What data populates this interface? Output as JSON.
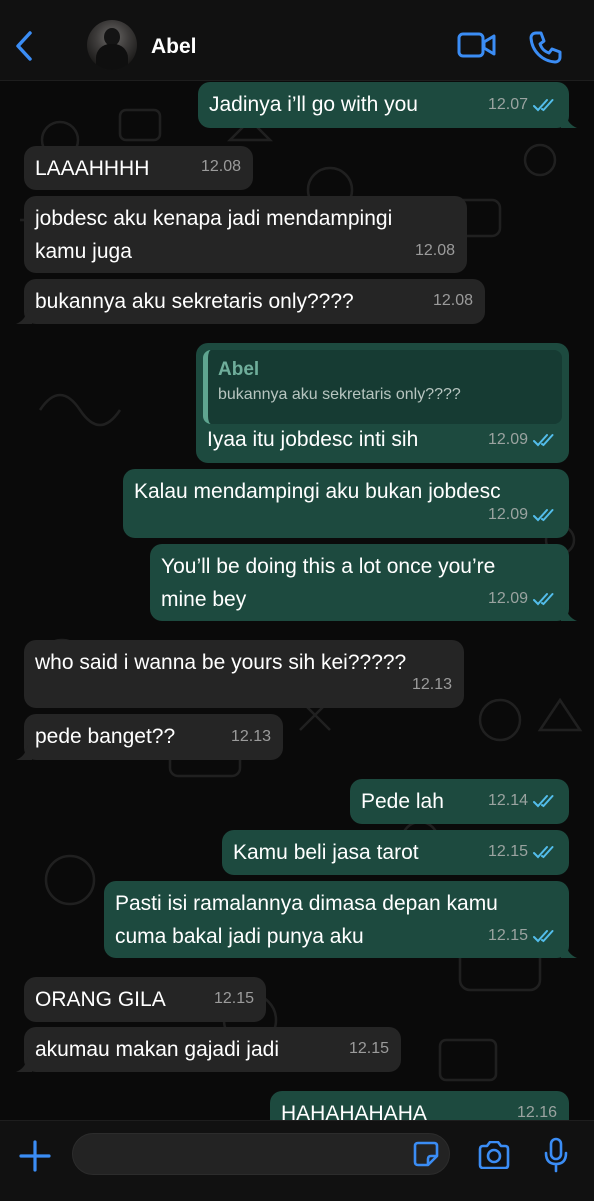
{
  "header": {
    "contact_name": "Abel"
  },
  "messages": [
    {
      "dir": "out",
      "text": "Jadinya i’ll go with you",
      "time": "12.07",
      "read": true
    },
    {
      "dir": "in",
      "text": "LAAAHHHH",
      "time": "12.08"
    },
    {
      "dir": "in",
      "text": "jobdesc aku kenapa jadi mendampingi\nkamu juga",
      "time": "12.08"
    },
    {
      "dir": "in",
      "text": "bukannya aku sekretaris only????",
      "time": "12.08"
    },
    {
      "dir": "out",
      "quote": {
        "name": "Abel",
        "text": "bukannya aku sekretaris only????"
      },
      "text": "Iyaa itu jobdesc inti sih",
      "time": "12.09",
      "read": true
    },
    {
      "dir": "out",
      "text": "Kalau mendampingi aku bukan jobdesc",
      "time": "12.09",
      "read": true
    },
    {
      "dir": "out",
      "text": "You’ll be doing this a lot once you’re\nmine bey",
      "time": "12.09",
      "read": true
    },
    {
      "dir": "in",
      "text": "who said i wanna be yours sih kei?????",
      "time": "12.13"
    },
    {
      "dir": "in",
      "text": "pede banget??",
      "time": "12.13"
    },
    {
      "dir": "out",
      "text": "Pede lah",
      "time": "12.14",
      "read": true
    },
    {
      "dir": "out",
      "text": "Kamu beli jasa tarot",
      "time": "12.15",
      "read": true
    },
    {
      "dir": "out",
      "text": "Pasti isi ramalannya dimasa depan kamu\ncuma bakal jadi punya aku",
      "time": "12.15",
      "read": true
    },
    {
      "dir": "in",
      "text": "ORANG GILA",
      "time": "12.15"
    },
    {
      "dir": "in",
      "text": "akumau makan gajadi jadi",
      "time": "12.15"
    },
    {
      "dir": "out",
      "text": "HAHAHAHAHA",
      "time": "12.16",
      "read": true
    }
  ],
  "colors": {
    "incoming_bubble": "#252525",
    "outgoing_bubble": "#1d4a3f",
    "accent_blue": "#3b8df5",
    "read_tick": "#53bdeb"
  },
  "icons": {
    "back": "chevron-left-icon",
    "video": "video-camera-icon",
    "call": "phone-icon",
    "plus": "plus-icon",
    "sticker": "sticker-icon",
    "camera": "camera-icon",
    "mic": "microphone-icon"
  },
  "input": {
    "placeholder": "",
    "value": ""
  }
}
